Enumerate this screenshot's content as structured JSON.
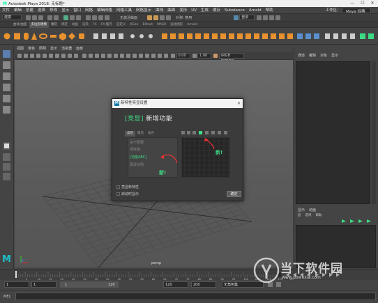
{
  "window": {
    "title": "Autodesk Maya 2018: 无标题*",
    "controls": [
      "—",
      "☐",
      "✕"
    ]
  },
  "menubar": {
    "items": [
      "文件",
      "编辑",
      "创建",
      "选择",
      "修改",
      "显示",
      "窗口",
      "网格",
      "编辑网格",
      "网格工具",
      "网格显示",
      "曲线",
      "曲面",
      "变形",
      "UV",
      "生成",
      "缓存",
      "Substance",
      "Arnold",
      "帮助"
    ],
    "workspace_label": "工作区:",
    "workspace_value": "Maya 经典"
  },
  "statusline": {
    "mode": "建模",
    "live_label": "无激活曲面",
    "symmetry_label": "对称: 禁用",
    "login_label": "登录"
  },
  "shelf": {
    "tabs": [
      "曲线/曲面",
      "多边形建模",
      "雕刻",
      "绑定",
      "动画",
      "渲染",
      "FX",
      "FX 缓存",
      "自定义",
      "XGen",
      "Bifrost",
      "MASH",
      "运动图形",
      "Arnold"
    ],
    "active_tab": 1
  },
  "viewport": {
    "menu": [
      "视图",
      "着色",
      "照明",
      "显示",
      "渲染器",
      "面板"
    ],
    "exposure": "0.00",
    "gamma": "1.00",
    "colorspace": "sRGB gamma",
    "camera_label": "persp"
  },
  "right_panel": {
    "tabs": [
      "通道",
      "编辑",
      "对象",
      "显示"
    ],
    "layer_tabs": [
      "显示",
      "动画"
    ],
    "layer_menu": [
      "层",
      "选项",
      "帮助"
    ]
  },
  "timeline": {
    "ticks": [
      "5",
      "10",
      "15",
      "20",
      "25",
      "30",
      "35",
      "40",
      "45",
      "50",
      "55",
      "60",
      "65",
      "70",
      "75",
      "80",
      "85",
      "90",
      "95",
      "100",
      "105",
      "110",
      "115",
      "120"
    ]
  },
  "rangebar": {
    "start": "1",
    "playback_start": "1",
    "range_value": "1",
    "range_end_mark": "120",
    "playback_end": "120",
    "end": "200",
    "character_set": "无角色集"
  },
  "mel": {
    "label": "MEL"
  },
  "dialog": {
    "title": "新特性亮显设置",
    "logo_letter": "M",
    "close": "✕",
    "heading_tag": "[亮显]",
    "heading_text": "新增功能",
    "tabs": [
      "类别",
      "最后",
      "角色"
    ],
    "list_items": [
      "关于概要",
      "项目窗",
      "[功能ABC]",
      "更改示例"
    ],
    "selected_item": 2,
    "annotation_1": "新!",
    "annotation_2": "新!",
    "checkbox_1": "亮显新特性",
    "checkbox_2": "启动时显示",
    "ok_button": "确定"
  },
  "watermark": {
    "title": "当下软件园",
    "url": "www.downxia.com",
    "brand_letter": "M"
  },
  "colors": {
    "accent_green": "#3ddc84",
    "maya_cyan": "#1ec0c9",
    "shelf_orange": "#e8922f"
  }
}
